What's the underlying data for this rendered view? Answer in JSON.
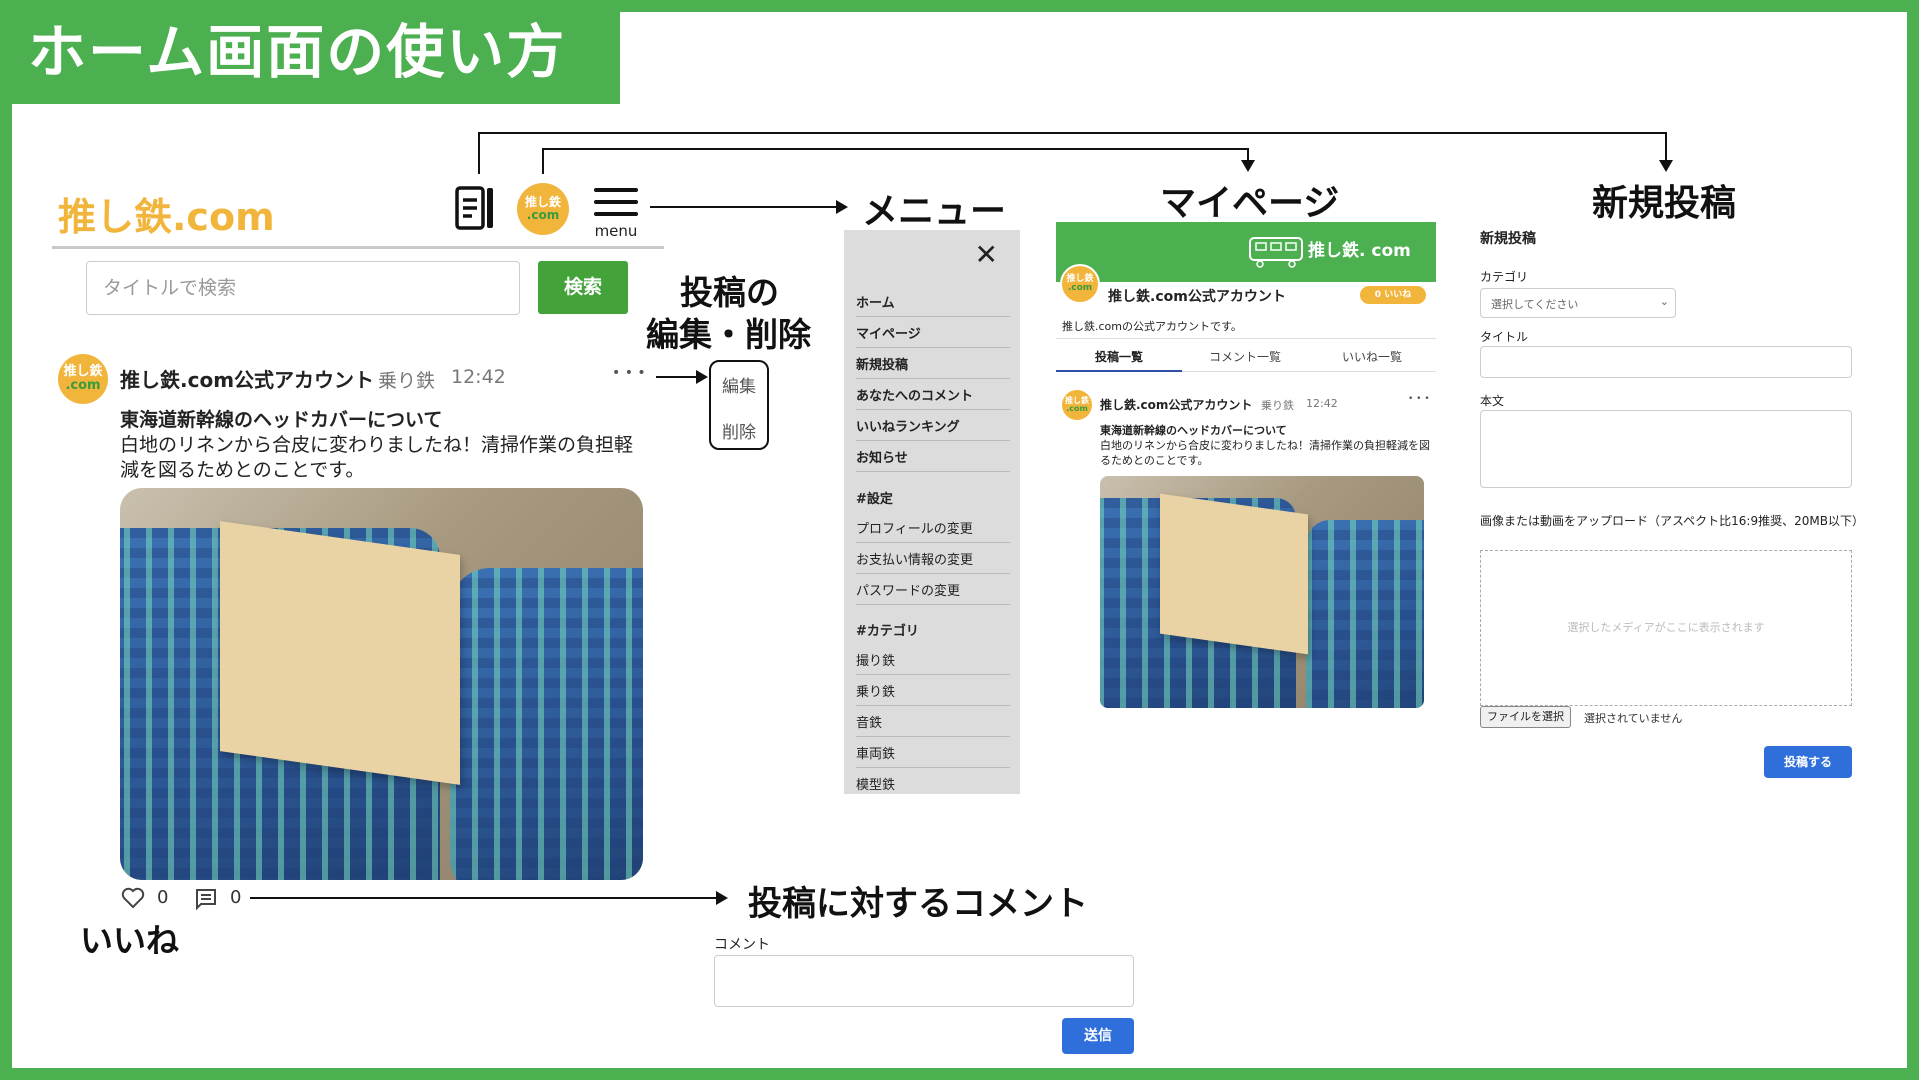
{
  "banner_title": "ホーム画面の使い方",
  "home": {
    "logo": "推し鉄.com",
    "avatar_top": "推し鉄",
    "avatar_bottom": ".com",
    "menu_label": "menu",
    "search_placeholder": "タイトルで検索",
    "search_button": "検索",
    "post": {
      "author": "推し鉄.com公式アカウント",
      "category": "乗り鉄",
      "time": "12:42",
      "more": "• • •",
      "title": "東海道新幹線のヘッドカバーについて",
      "body": "白地のリネンから合皮に変わりましたね！清掃作業の負担軽減を図るためとのことです。",
      "like_count": "0",
      "comment_count": "0"
    },
    "edit_popup": {
      "edit": "編集",
      "delete": "削除"
    }
  },
  "callouts": {
    "menu": "メニュー",
    "mypage": "マイページ",
    "new_post": "新規投稿",
    "edit_delete_line1": "投稿の",
    "edit_delete_line2": "編集・削除",
    "like": "いいね",
    "comment": "投稿に対するコメント"
  },
  "comment_form": {
    "label": "コメント",
    "submit": "送信"
  },
  "menu_panel": {
    "close": "✕",
    "main_items": [
      "ホーム",
      "マイページ",
      "新規投稿",
      "あなたへのコメント",
      "いいねランキング",
      "お知らせ"
    ],
    "settings_header": "#設定",
    "settings_items": [
      "プロフィールの変更",
      "お支払い情報の変更",
      "パスワードの変更"
    ],
    "category_header": "#カテゴリ",
    "category_items": [
      "撮り鉄",
      "乗り鉄",
      "音鉄",
      "車両鉄",
      "模型鉄"
    ]
  },
  "mypage": {
    "banner_logo": "推し鉄. com",
    "account_name": "推し鉄.com公式アカウント",
    "likes_badge": "0 いいね",
    "description": "推し鉄.comの公式アカウントです。",
    "tabs": [
      "投稿一覧",
      "コメント一覧",
      "いいね一覧"
    ],
    "post": {
      "author": "推し鉄.com公式アカウント",
      "category": "乗り鉄",
      "time": "12:42",
      "more": "• • •",
      "title": "東海道新幹線のヘッドカバーについて",
      "body": "白地のリネンから合皮に変わりましたね！清掃作業の負担軽減を図るためとのことです。"
    }
  },
  "new_post_form": {
    "heading": "新規投稿",
    "category_label": "カテゴリ",
    "category_select": "選択してください",
    "title_label": "タイトル",
    "body_label": "本文",
    "upload_label": "画像または動画をアップロード（アスペクト比16:9推奨、20MB以下）",
    "preview_placeholder": "選択したメディアがここに表示されます",
    "file_button": "ファイルを選択",
    "file_status": "選択されていません",
    "submit": "投稿する"
  },
  "colors": {
    "green": "#4caf50",
    "gold": "#f2b53c",
    "blue": "#2f6fdc"
  }
}
